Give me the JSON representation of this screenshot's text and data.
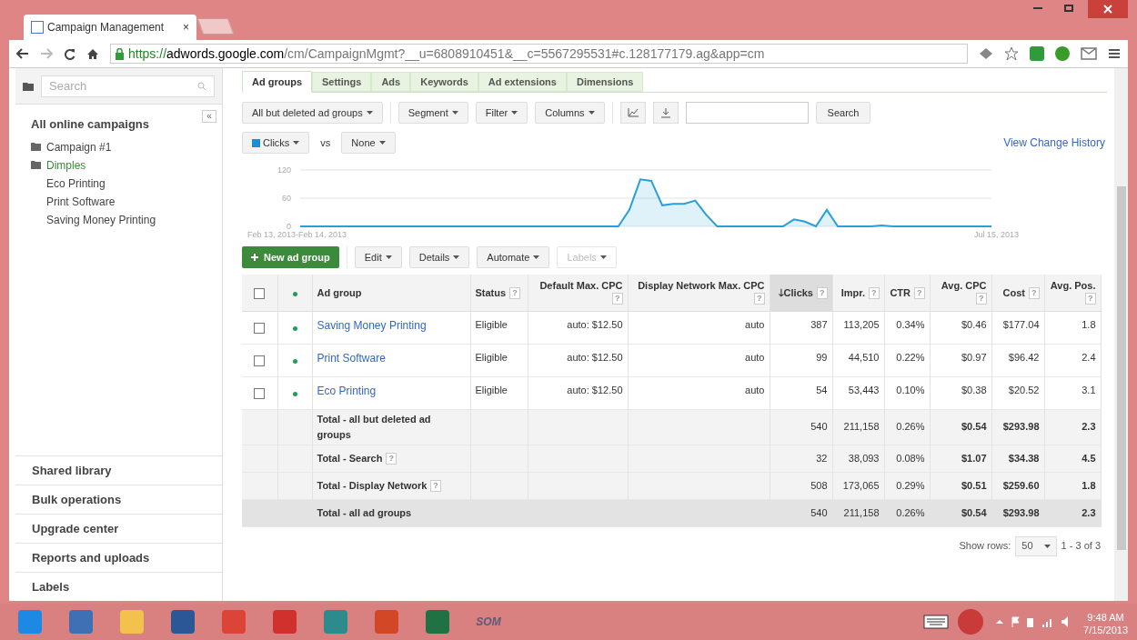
{
  "browser": {
    "tab": {
      "title": "Campaign Management",
      "close": "×"
    },
    "url": {
      "scheme": "https://",
      "host": "adwords.google.com",
      "path": "/cm/CampaignMgmt?__u=6808910451&__c=5567295531#c.128177179.ag&app=cm"
    }
  },
  "sidebar": {
    "search": {
      "placeholder": "Search"
    },
    "collapse": "«",
    "title": "All online campaigns",
    "tree": [
      {
        "label": "Campaign #1",
        "selected": false
      },
      {
        "label": "Dimples",
        "selected": true,
        "children": [
          {
            "label": "Eco Printing"
          },
          {
            "label": "Print Software"
          },
          {
            "label": "Saving Money Printing"
          }
        ]
      }
    ],
    "sections": [
      "Shared library",
      "Bulk operations",
      "Upgrade center",
      "Reports and uploads",
      "Labels"
    ]
  },
  "tabs": [
    {
      "label": "Ad groups",
      "selected": true
    },
    {
      "label": "Settings",
      "selected": false
    },
    {
      "label": "Ads",
      "selected": false
    },
    {
      "label": "Keywords",
      "selected": false
    },
    {
      "label": "Ad extensions",
      "selected": false
    },
    {
      "label": "Dimensions",
      "selected": false
    }
  ],
  "toolbar": {
    "filter": "All but deleted ad groups",
    "buttons": [
      "Segment",
      "Filter",
      "Columns"
    ],
    "search_button": "Search"
  },
  "metric": {
    "primary": "Clicks",
    "vs": "vs",
    "secondary": "None"
  },
  "view_change_history": "View Change History",
  "chart": {
    "chart_data": {
      "type": "area",
      "yticks": [
        0,
        60,
        120
      ],
      "ylim": [
        0,
        120
      ],
      "categories": [
        "Feb 13, 2013-Feb 14, 2013",
        null,
        null,
        null,
        null,
        null,
        null,
        null,
        null,
        null,
        null,
        null,
        null,
        null,
        null,
        null,
        null,
        null,
        null,
        null,
        null,
        null,
        null,
        null,
        null,
        null,
        null,
        null,
        null,
        null,
        null,
        null,
        null,
        null,
        null,
        null,
        null,
        null,
        null,
        null,
        null,
        null,
        null,
        null,
        null,
        null,
        null,
        null,
        null,
        null,
        null,
        null,
        null,
        null,
        null,
        null,
        null,
        null,
        null,
        null,
        null,
        null,
        null,
        "Jul 15, 2013"
      ],
      "values": [
        0,
        0,
        0,
        0,
        0,
        0,
        0,
        0,
        0,
        0,
        0,
        0,
        0,
        0,
        0,
        0,
        0,
        0,
        0,
        0,
        0,
        0,
        0,
        0,
        0,
        0,
        0,
        0,
        0,
        0,
        35,
        100,
        97,
        45,
        48,
        48,
        55,
        25,
        0,
        0,
        0,
        0,
        0,
        0,
        0,
        15,
        10,
        0,
        35,
        0,
        0,
        0,
        0,
        2,
        0,
        0,
        0,
        0,
        0,
        0,
        0,
        0,
        0,
        0
      ]
    }
  },
  "actions": {
    "new_button": "New ad group",
    "menus": [
      {
        "label": "Edit",
        "disabled": false
      },
      {
        "label": "Details",
        "disabled": false
      },
      {
        "label": "Automate",
        "disabled": false
      },
      {
        "label": "Labels",
        "disabled": true
      }
    ]
  },
  "table": {
    "select_all_checked": false,
    "columns": [
      {
        "label": "Ad group",
        "sorted": false
      },
      {
        "label": "Status",
        "help": "?",
        "sorted": false
      },
      {
        "label": "Default Max. CPC",
        "help": "?",
        "sorted": false
      },
      {
        "label": "Display Network Max. CPC",
        "help": "?",
        "sorted": false
      },
      {
        "label": "Clicks",
        "help": "?",
        "sorted": true,
        "arrow": "🡓"
      },
      {
        "label": "Impr.",
        "help": "?",
        "sorted": false
      },
      {
        "label": "CTR",
        "help": "?",
        "sorted": false
      },
      {
        "label": "Avg. CPC",
        "help": "?",
        "sorted": false
      },
      {
        "label": "Cost",
        "help": "?",
        "sorted": false
      },
      {
        "label": "Avg. Pos.",
        "help": "?",
        "sorted": false
      }
    ],
    "rows": [
      {
        "kind": "item",
        "checked": false,
        "cells": [
          "Saving Money Printing",
          "Eligible",
          "auto: $12.50",
          "auto",
          "387",
          "113,205",
          "0.34%",
          "$0.46",
          "$177.04",
          "1.8"
        ]
      },
      {
        "kind": "item",
        "checked": false,
        "cells": [
          "Print Software",
          "Eligible",
          "auto: $12.50",
          "auto",
          "99",
          "44,510",
          "0.22%",
          "$0.97",
          "$96.42",
          "2.4"
        ]
      },
      {
        "kind": "item",
        "checked": false,
        "cells": [
          "Eco Printing",
          "Eligible",
          "auto: $12.50",
          "auto",
          "54",
          "53,443",
          "0.10%",
          "$0.38",
          "$20.52",
          "3.1"
        ]
      },
      {
        "kind": "total",
        "cells": [
          "Total - all but deleted ad groups",
          "",
          "",
          "",
          "540",
          "211,158",
          "0.26%",
          "$0.54",
          "$293.98",
          "2.3"
        ]
      },
      {
        "kind": "total",
        "help": "?",
        "cells": [
          "Total - Search",
          "",
          "",
          "",
          "32",
          "38,093",
          "0.08%",
          "$1.07",
          "$34.38",
          "4.5"
        ]
      },
      {
        "kind": "total",
        "help": "?",
        "cells": [
          "Total - Display Network",
          "",
          "",
          "",
          "508",
          "173,065",
          "0.29%",
          "$0.51",
          "$259.60",
          "1.8"
        ]
      },
      {
        "kind": "grand",
        "cells": [
          "Total - all ad groups",
          "",
          "",
          "",
          "540",
          "211,158",
          "0.26%",
          "$0.54",
          "$293.98",
          "2.3"
        ]
      }
    ]
  },
  "pagination": {
    "label": "Show rows:",
    "rows": "50",
    "range": "1 - 3 of 3"
  },
  "taskbar": {
    "apps": [
      {
        "color": "#1e88e5"
      },
      {
        "color": "#3f6fb5"
      },
      {
        "color": "#f2c14e"
      },
      {
        "color": "#2b5797"
      },
      {
        "color": "#db4437"
      },
      {
        "color": "#d0312d"
      },
      {
        "color": "#2e8b8b"
      },
      {
        "color": "#d24726"
      },
      {
        "color": "#207245"
      },
      {
        "label": "SOM"
      }
    ],
    "time": "9:48 AM",
    "date": "7/15/2013"
  }
}
